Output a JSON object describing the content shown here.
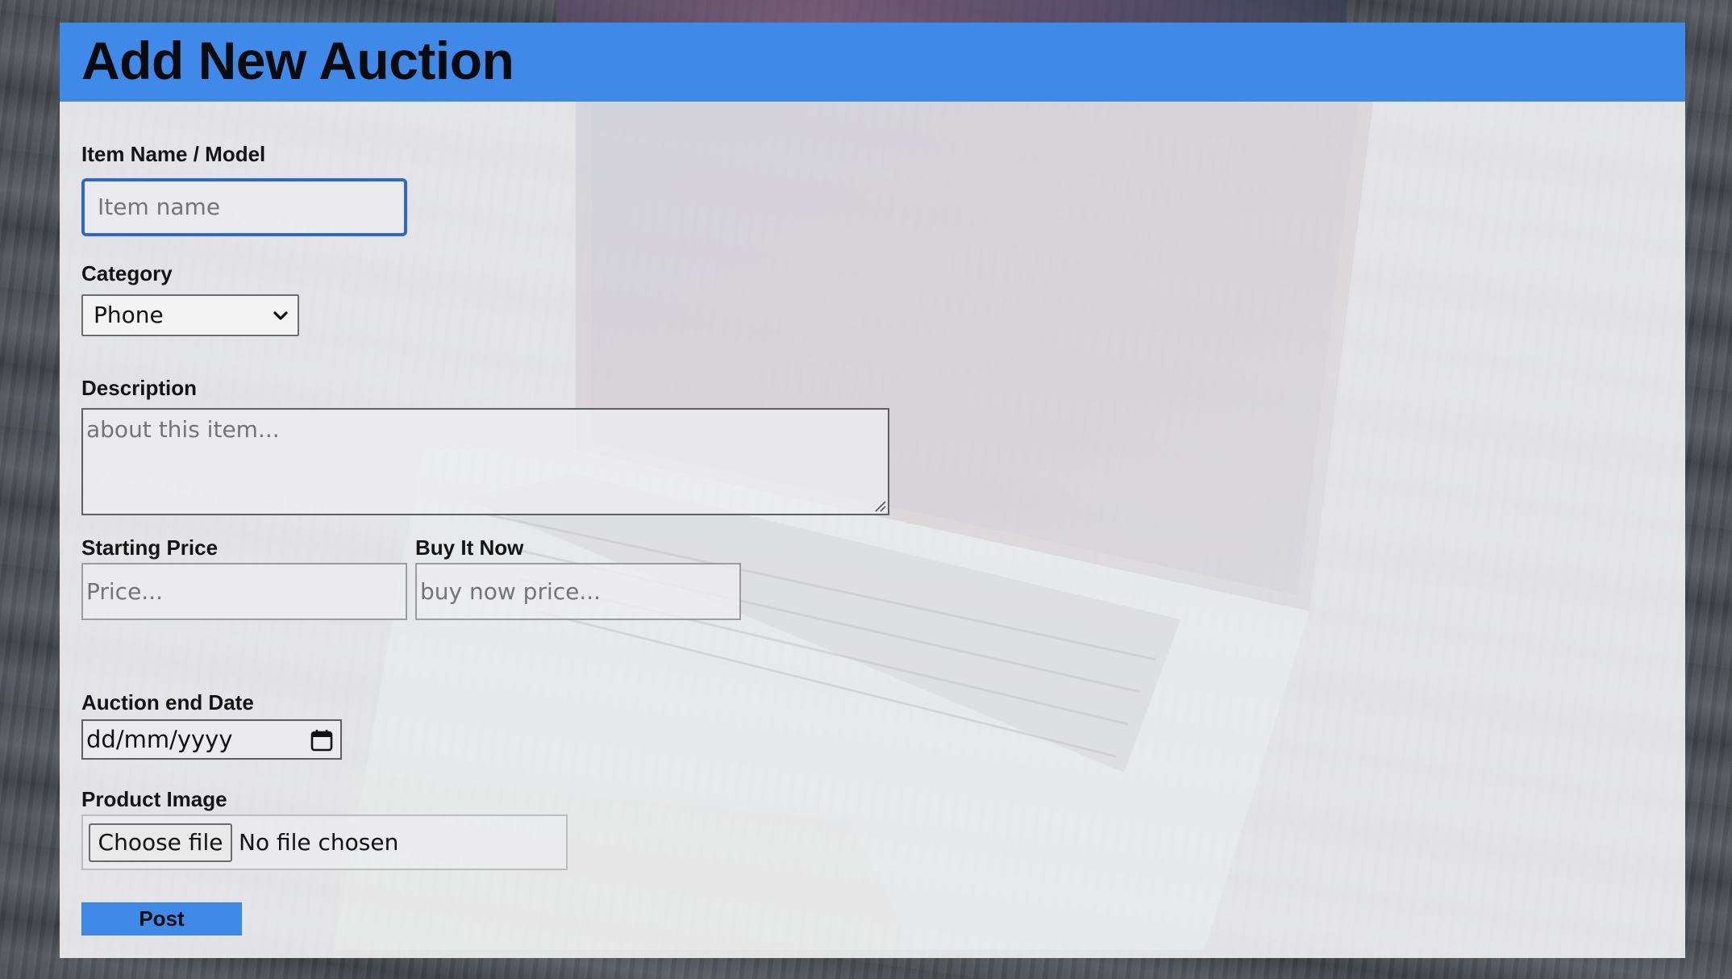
{
  "header": {
    "title": "Add New Auction"
  },
  "form": {
    "item_name": {
      "label": "Item Name / Model",
      "placeholder": "Item name",
      "value": ""
    },
    "category": {
      "label": "Category",
      "selected": "Phone"
    },
    "description": {
      "label": "Description",
      "placeholder": "about this item..."
    },
    "starting_price": {
      "label": "Starting Price",
      "placeholder": "Price..."
    },
    "buy_it_now": {
      "label": "Buy It Now",
      "placeholder": "buy now price..."
    },
    "end_date": {
      "label": "Auction end Date",
      "placeholder": "dd/mm/yyyy"
    },
    "product_image": {
      "label": "Product Image",
      "button_label": "Choose file",
      "status": "No file chosen"
    },
    "submit_label": "Post"
  },
  "colors": {
    "accent": "#3f8ae8",
    "focus_ring": "#2d67d1",
    "panel_bg": "#f0f0f2"
  },
  "icons": {
    "select_arrow": "chevron-down-icon",
    "date_picker": "calendar-icon",
    "textarea_resize": "resize-grip-icon"
  }
}
